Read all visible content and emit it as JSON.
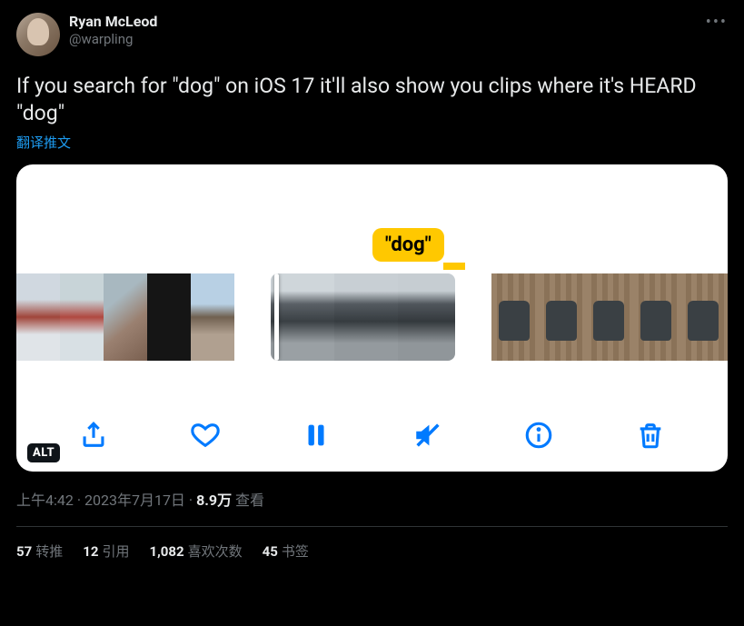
{
  "author": {
    "display_name": "Ryan McLeod",
    "handle": "@warpling"
  },
  "text": "If you search for \"dog\" on iOS 17 it'll also show you clips where it's HEARD \"dog\"",
  "translate_label": "翻译推文",
  "media": {
    "caption_bubble": "\"dog\"",
    "alt_badge": "ALT"
  },
  "meta": {
    "time": "上午4:42",
    "date": "2023年7月17日",
    "views_number": "8.9万",
    "views_label": "查看",
    "separator": " · "
  },
  "engagement": {
    "retweets": {
      "count": "57",
      "label": "转推"
    },
    "quotes": {
      "count": "12",
      "label": "引用"
    },
    "likes": {
      "count": "1,082",
      "label": "喜欢次数"
    },
    "bookmarks": {
      "count": "45",
      "label": "书签"
    }
  }
}
